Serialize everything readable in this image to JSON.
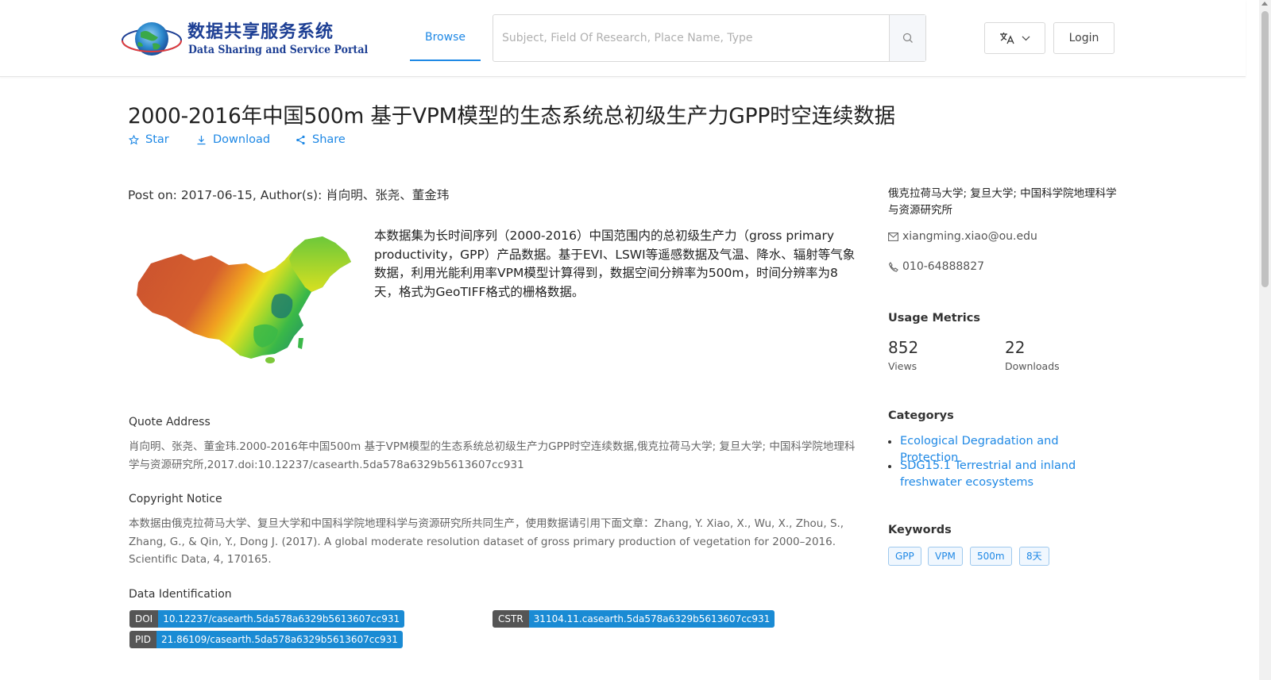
{
  "header": {
    "logo": {
      "cn": "数据共享服务系统",
      "en": "Data Sharing and Service Portal",
      "seal_text": "地球大数据科学数据中心"
    },
    "nav": {
      "browse": "Browse"
    },
    "search": {
      "placeholder": "Subject, Field Of Research, Place Name, Type",
      "value": ""
    },
    "lang_icon": "translate-icon",
    "login": "Login"
  },
  "dataset": {
    "title": "2000-2016年中国500m 基于VPM模型的生态系统总初级生产力GPP时空连续数据",
    "actions": {
      "star": "Star",
      "download": "Download",
      "share": "Share"
    },
    "post_line": "Post on: 2017-06-15, Author(s): 肖向明、张尧、董金玮",
    "description": "本数据集为长时间序列（2000-2016）中国范围内的总初级生产力（gross primary productivity，GPP）产品数据。基于EVI、LSWI等遥感数据及气温、降水、辐射等气象数据，利用光能利用率VPM模型计算得到，数据空间分辨率为500m，时间分辨率为8天，格式为GeoTIFF格式的栅格数据。",
    "quote": {
      "label": "Quote Address",
      "text": "肖向明、张尧、董金玮.2000-2016年中国500m 基于VPM模型的生态系统总初级生产力GPP时空连续数据,俄克拉荷马大学; 复旦大学; 中国科学院地理科学与资源研究所,2017.doi:10.12237/casearth.5da578a6329b5613607cc931"
    },
    "copyright": {
      "label": "Copyright Notice",
      "text": "本数据由俄克拉荷马大学、复旦大学和中国科学院地理科学与资源研究所共同生产，使用数据请引用下面文章：Zhang, Y. Xiao, X., Wu, X., Zhou, S., Zhang, G., & Qin, Y., Dong J. (2017). A global moderate resolution dataset of gross primary production of vegetation for 2000–2016. Scientific Data, 4, 170165."
    },
    "identification": {
      "label": "Data Identification",
      "doi": {
        "key": "DOI",
        "value": "10.12237/casearth.5da578a6329b5613607cc931"
      },
      "cstr": {
        "key": "CSTR",
        "value": "31104.11.casearth.5da578a6329b5613607cc931"
      },
      "pid": {
        "key": "PID",
        "value": "21.86109/casearth.5da578a6329b5613607cc931"
      }
    }
  },
  "sidebar": {
    "org": "俄克拉荷马大学; 复旦大学; 中国科学院地理科学与资源研究所",
    "email": "xiangming.xiao@ou.edu",
    "phone": "010-64888827",
    "usage": {
      "heading": "Usage Metrics",
      "views": "852",
      "views_label": "Views",
      "downloads": "22",
      "downloads_label": "Downloads"
    },
    "categories": {
      "heading": "Categorys",
      "items": [
        "Ecological Degradation and Protection",
        "SDG15.1 Terrestrial and inland freshwater ecosystems"
      ]
    },
    "keywords": {
      "heading": "Keywords",
      "items": [
        "GPP",
        "VPM",
        "500m",
        "8天"
      ]
    }
  },
  "colors": {
    "accent": "#1e88e5",
    "brand": "#1d3f94",
    "badge_key": "#555555",
    "badge_value": "#1a8bd4"
  }
}
